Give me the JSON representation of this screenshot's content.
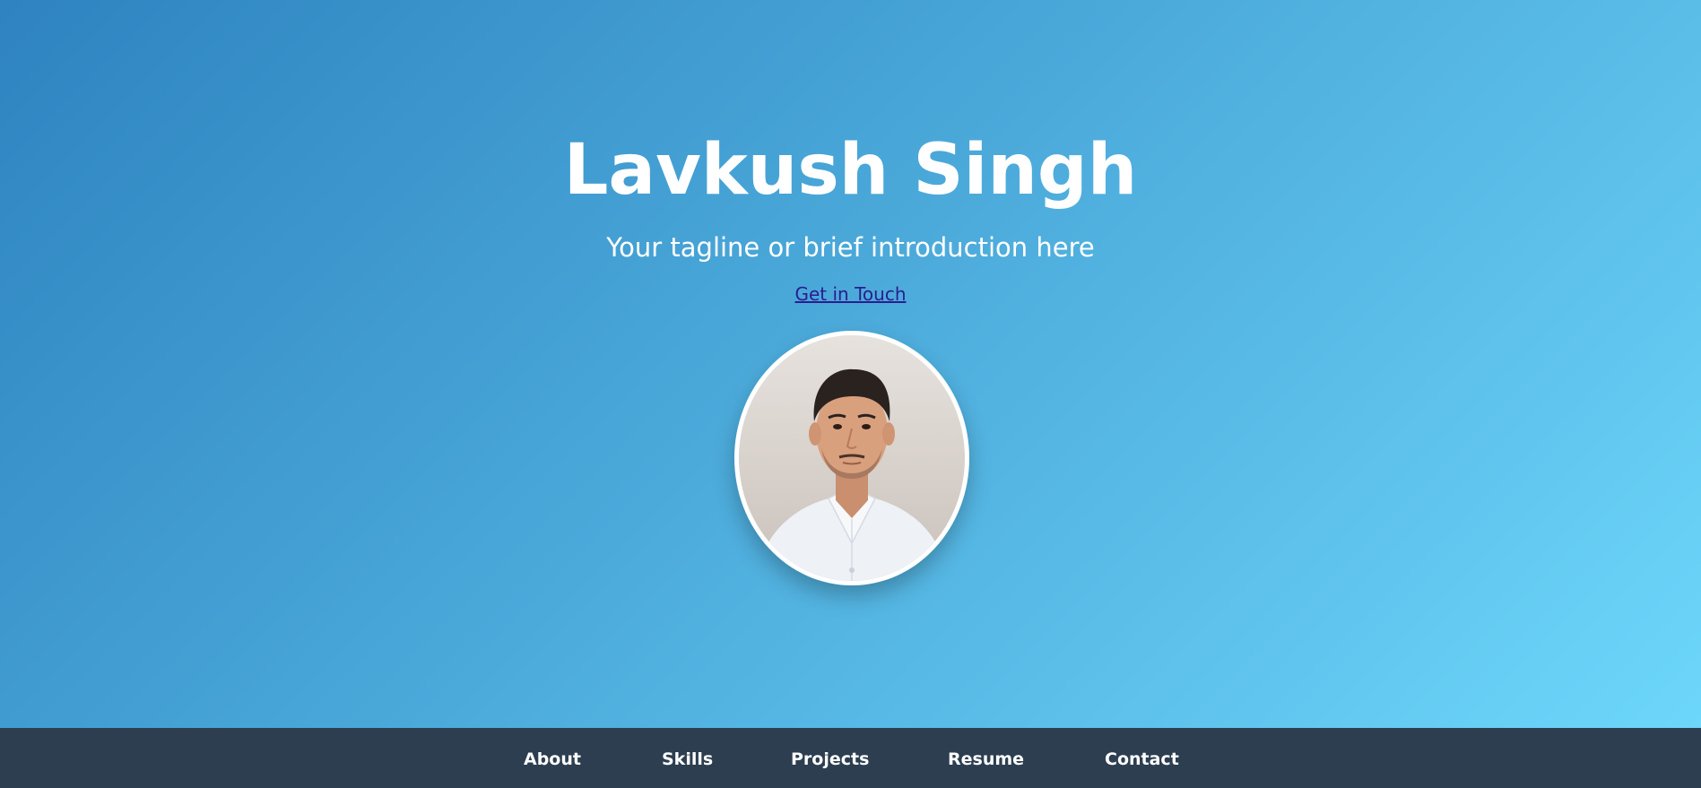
{
  "hero": {
    "name": "Lavkush Singh",
    "tagline": "Your tagline or brief introduction here",
    "cta_label": "Get in Touch",
    "gradient_colors": [
      "#2e83c0",
      "#4aa8d9",
      "#6dd6fa"
    ]
  },
  "avatar": {
    "alt": "Profile photo"
  },
  "nav": {
    "background": "#2c3e50",
    "items": [
      {
        "label": "About"
      },
      {
        "label": "Skills"
      },
      {
        "label": "Projects"
      },
      {
        "label": "Resume"
      },
      {
        "label": "Contact"
      }
    ]
  }
}
